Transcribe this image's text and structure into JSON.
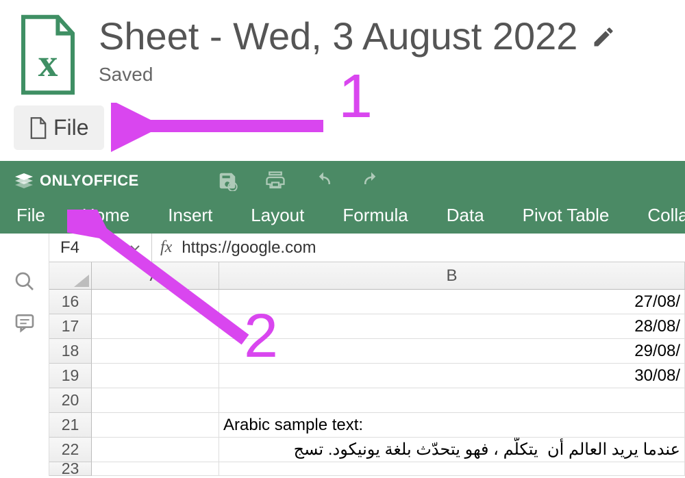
{
  "header": {
    "title": "Sheet - Wed, 3 August 2022",
    "status": "Saved"
  },
  "file_button": {
    "label": "File"
  },
  "brand": "ONLYOFFICE",
  "tabs": [
    "File",
    "Home",
    "Insert",
    "Layout",
    "Formula",
    "Data",
    "Pivot Table",
    "Collaboration"
  ],
  "cell_ref": "F4",
  "fx_symbol": "fx",
  "formula_value": "https://google.com",
  "columns": [
    "A",
    "B"
  ],
  "rows": [
    {
      "num": "16",
      "a": "",
      "b": "27/08/"
    },
    {
      "num": "17",
      "a": "",
      "b": "28/08/"
    },
    {
      "num": "18",
      "a": "",
      "b": "29/08/"
    },
    {
      "num": "19",
      "a": "",
      "b": "30/08/"
    },
    {
      "num": "20",
      "a": "",
      "b": ""
    },
    {
      "num": "21",
      "a": "",
      "b": "Arabic sample text:"
    },
    {
      "num": "22",
      "a": "",
      "b": "عندما يريد العالم أن ‪يتكلّم ‬ ، فهو يتحدّث بلغة يونيكود. تسج"
    },
    {
      "num": "23",
      "a": "",
      "b": ""
    }
  ],
  "annotations": {
    "one": "1",
    "two": "2"
  }
}
